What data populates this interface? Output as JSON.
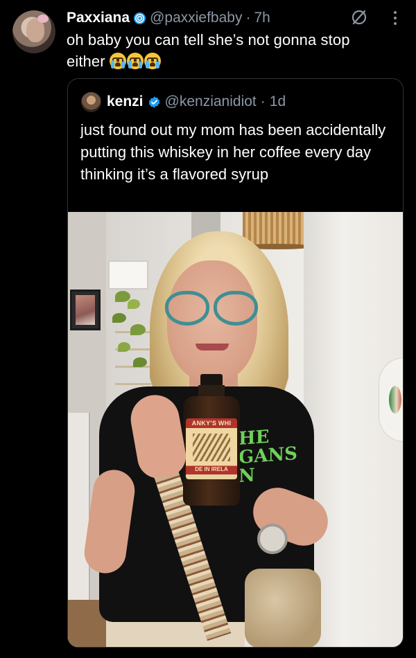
{
  "tweet": {
    "author_name": "Paxxiana",
    "handle": "@paxxiefbaby",
    "separator": "·",
    "time": "7h",
    "text": "oh baby you can tell she’s not gonna stop either",
    "emoji": [
      "loudly-crying-face",
      "loudly-crying-face",
      "loudly-crying-face"
    ]
  },
  "quoted": {
    "author_name": "kenzi",
    "verified": true,
    "handle": "@kenzianidiot",
    "separator": "·",
    "time": "1d",
    "text": "just found out my mom has been accidentally putting this whiskey in her coffee every day thinking it’s a flavored syrup"
  },
  "photo": {
    "bottle_label_top": "ANKY'S WHI",
    "bottle_label_bottom": "DE IN IRELA",
    "shirt_text_lines": [
      "HE",
      "GANS",
      "N"
    ]
  },
  "colors": {
    "background": "#000000",
    "text_primary": "#e7e9ea",
    "text_secondary": "#8b98a5",
    "verified_blue": "#1d9bf0",
    "border": "#2f3336"
  },
  "icons": {
    "grok": "grok-icon",
    "more": "more-icon",
    "verified": "verified-badge-icon",
    "affiliate": "affiliate-badge-icon"
  }
}
